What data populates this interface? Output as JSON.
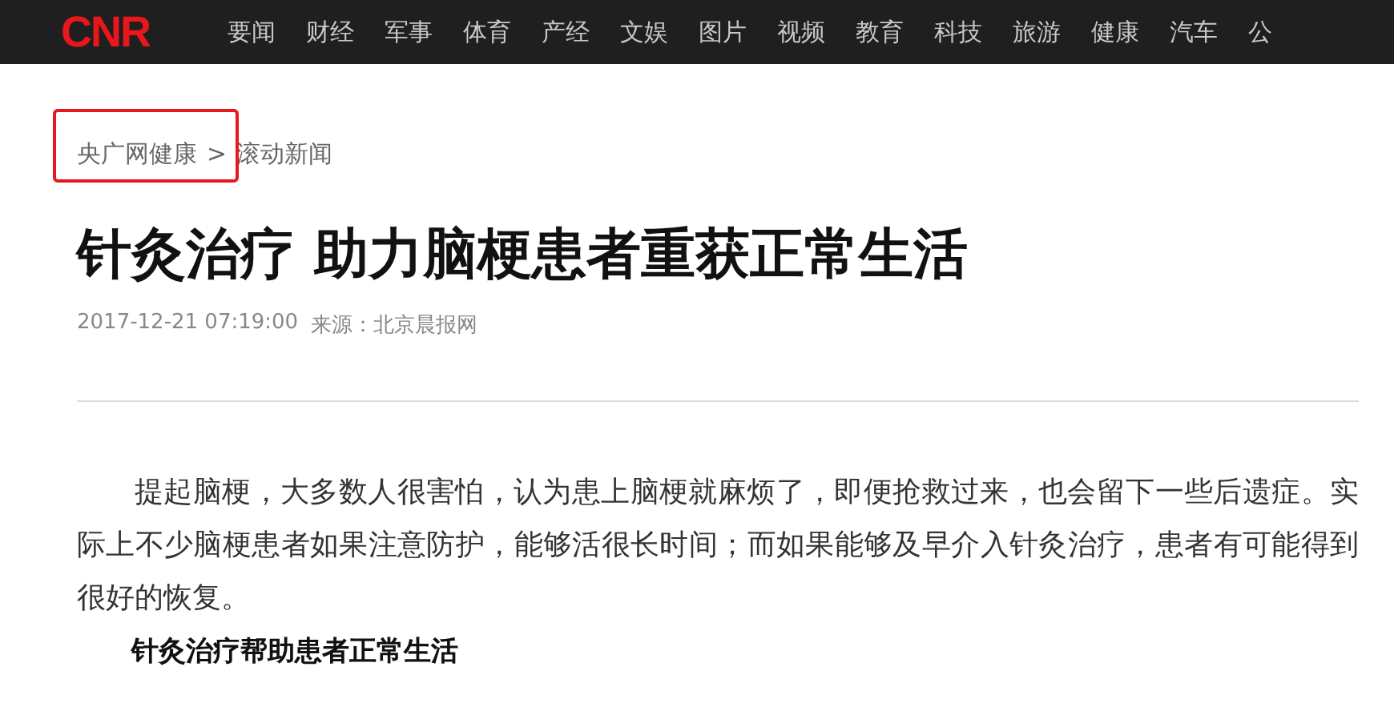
{
  "nav": {
    "logo": "CNR",
    "items": [
      "要闻",
      "财经",
      "军事",
      "体育",
      "产经",
      "文娱",
      "图片",
      "视频",
      "教育",
      "科技",
      "旅游",
      "健康",
      "汽车",
      "公"
    ]
  },
  "breadcrumb": {
    "items": [
      "央广网健康",
      "滚动新闻"
    ],
    "separator": ">"
  },
  "article": {
    "title": "针灸治疗 助力脑梗患者重获正常生活",
    "date": "2017-12-21 07:19:00",
    "source": "来源：北京晨报网",
    "paragraphs": [
      {
        "kind": "text",
        "text": "提起脑梗，大多数人很害怕，认为患上脑梗就麻烦了，即便抢救过来，也会留下一些后遗症。实际上不少脑梗患者如果注意防护，能够活很长时间；而如果能够及早介入针灸治疗，患者有可能得到很好的恢复。"
      },
      {
        "kind": "heading",
        "text": "针灸治疗帮助患者正常生活"
      }
    ]
  }
}
